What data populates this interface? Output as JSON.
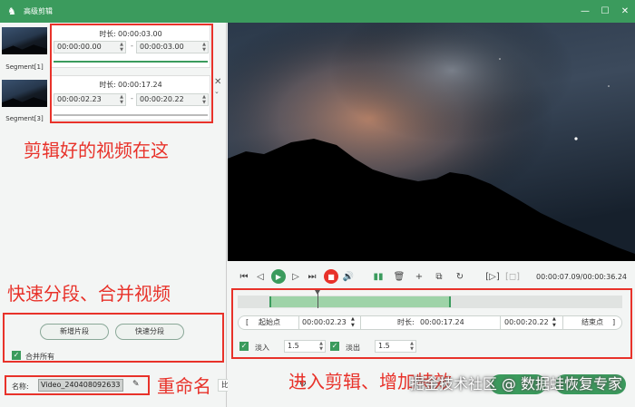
{
  "window": {
    "title": "高级剪辑"
  },
  "segments": [
    {
      "thumb_label": "Segment[1]",
      "duration_key": "时长:",
      "duration": "00:00:03.00",
      "start": "00:00:00.00",
      "end": "00:00:03.00"
    },
    {
      "thumb_label": "Segment[3]",
      "duration_key": "时长:",
      "duration": "00:00:17.24",
      "start": "00:00:02.23",
      "end": "00:00:20.22"
    }
  ],
  "annotations": {
    "clips_here": "剪辑好的视频在这",
    "split_merge": "快速分段、合并视频",
    "rename": "重命名",
    "enter_edit": "进入剪辑、增加特效"
  },
  "left_actions": {
    "new_segment": "新增片段",
    "quick_split": "快速分段",
    "merge_all": "合并所有"
  },
  "name_row": {
    "label": "名称:",
    "value": "Video_240408092633"
  },
  "resolution_row": {
    "value": "比:Auto"
  },
  "player": {
    "time": "00:00:07.09/00:00:36.24"
  },
  "timeline": {
    "selection_start": 0.083,
    "selection_end": 0.555,
    "playhead": 0.207
  },
  "trim": {
    "start_label": "起始点",
    "start_value": "00:00:02.23",
    "duration_label": "时长:",
    "duration_value": "00:00:17.24",
    "end_value": "00:00:20.22",
    "end_label": "结束点"
  },
  "fade": {
    "fade_in_label": "淡入",
    "fade_in_value": "1.5",
    "fade_out_label": "淡出",
    "fade_out_value": "1.5"
  },
  "watermark": "掘金技术社区 @ 数据蛙恢复专家",
  "colors": {
    "accent": "#3b9b5d",
    "annotation": "#e8322a"
  }
}
